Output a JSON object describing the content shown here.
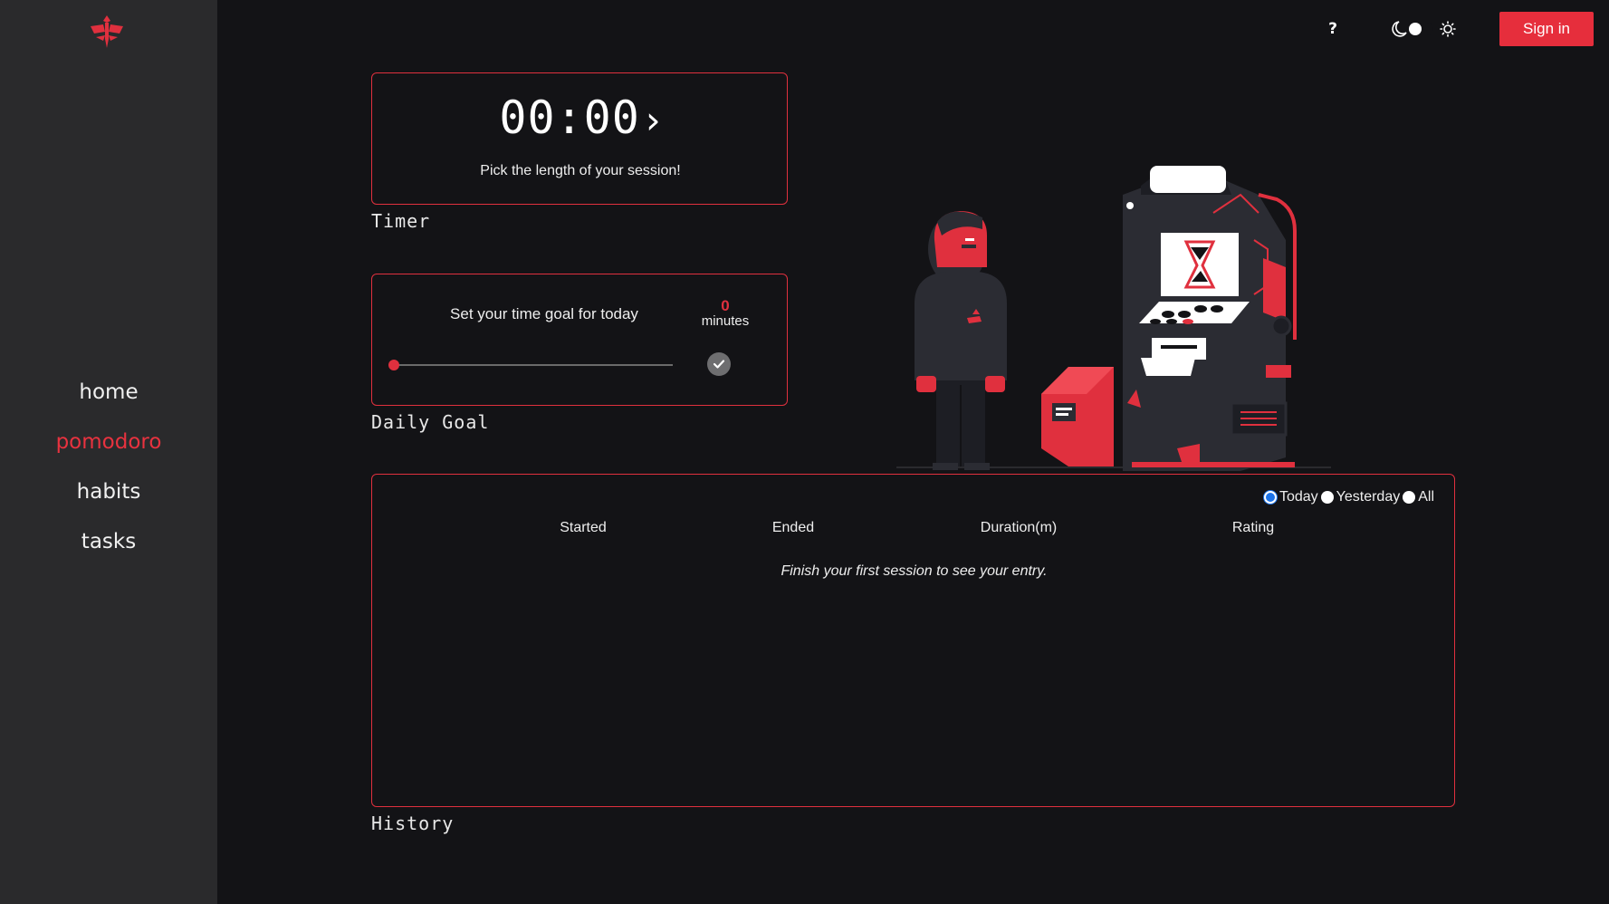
{
  "nav": {
    "items": [
      {
        "label": "home",
        "active": false
      },
      {
        "label": "pomodoro",
        "active": true
      },
      {
        "label": "habits",
        "active": false
      },
      {
        "label": "tasks",
        "active": false
      }
    ]
  },
  "topbar": {
    "help_label": "?",
    "theme": "dark",
    "signin_label": "Sign in"
  },
  "timer": {
    "value": "00:00",
    "caption": "Pick the length of your session!",
    "section_label": "Timer"
  },
  "goal": {
    "text": "Set your time goal for today",
    "minutes_value": "0",
    "minutes_unit": "minutes",
    "slider_value": 0,
    "section_label": "Daily Goal"
  },
  "history": {
    "filters": [
      {
        "label": "Today",
        "checked": true
      },
      {
        "label": "Yesterday",
        "checked": false
      },
      {
        "label": "All",
        "checked": false
      }
    ],
    "columns": [
      "Started",
      "Ended",
      "Duration(m)",
      "Rating"
    ],
    "empty_message": "Finish your first session to see your entry.",
    "section_label": "History"
  },
  "colors": {
    "accent": "#e62e3c",
    "background": "#131316",
    "sidebar": "#2a2a2c"
  }
}
